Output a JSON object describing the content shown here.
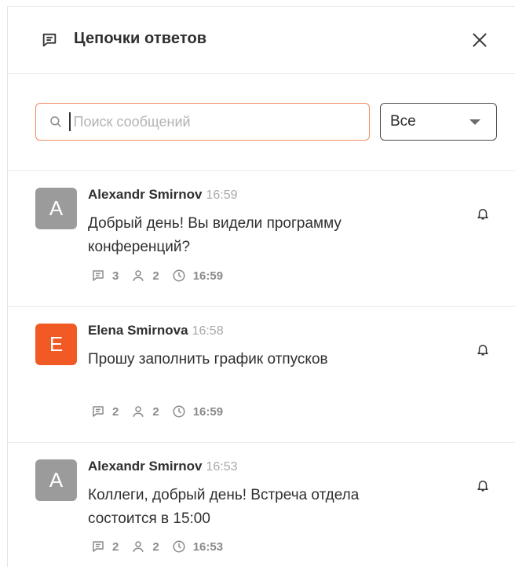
{
  "header": {
    "title": "Цепочки ответов"
  },
  "search": {
    "placeholder": "Поиск сообщений",
    "value": ""
  },
  "filter": {
    "selected": "Все"
  },
  "colors": {
    "accent": "#f15a24",
    "avatar_gray": "#9b9b9b"
  },
  "threads": [
    {
      "initial": "A",
      "author": "Alexandr Smirnov",
      "time": "16:59",
      "text": "Добрый день! Вы видели программу конференций?",
      "replies": "3",
      "participants": "2",
      "last_reply": "16:59",
      "avatar_color": "#9b9b9b"
    },
    {
      "initial": "E",
      "author": "Elena Smirnova",
      "time": "16:58",
      "text": "Прошу заполнить график отпусков",
      "replies": "2",
      "participants": "2",
      "last_reply": "16:59",
      "avatar_color": "#f15a24"
    },
    {
      "initial": "A",
      "author": "Alexandr Smirnov",
      "time": "16:53",
      "text": "Коллеги, добрый день! Встреча отдела состоится в 15:00",
      "replies": "2",
      "participants": "2",
      "last_reply": "16:53",
      "avatar_color": "#9b9b9b"
    }
  ]
}
